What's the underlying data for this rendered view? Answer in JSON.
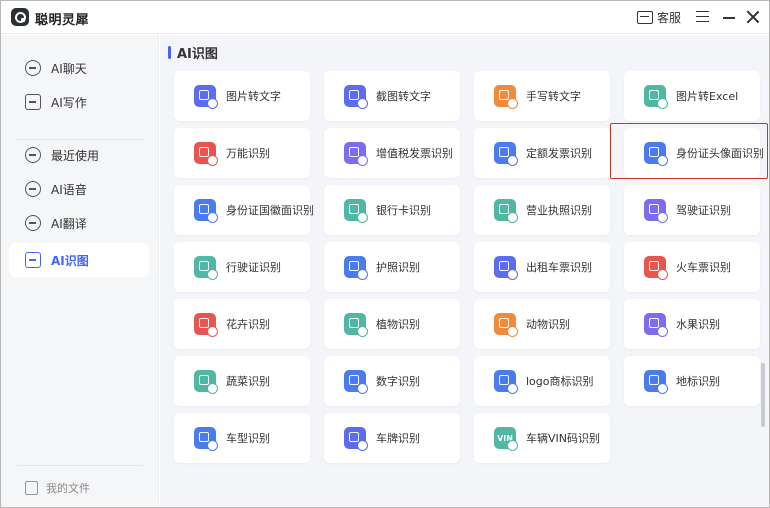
{
  "app": {
    "title": "聪明灵犀"
  },
  "titlebar": {
    "service_label": "客服"
  },
  "sidebar": {
    "items": [
      {
        "label": "AI聊天",
        "active": false
      },
      {
        "label": "AI写作",
        "active": false
      },
      {
        "label": "最近使用",
        "active": false
      },
      {
        "label": "AI语音",
        "active": false
      },
      {
        "label": "AI翻译",
        "active": false
      },
      {
        "label": "AI识图",
        "active": true
      }
    ],
    "files_label": "我的文件"
  },
  "main": {
    "section_title": "AI识图",
    "cards": [
      {
        "label": "图片转文字",
        "color": "#5b6cf0"
      },
      {
        "label": "截图转文字",
        "color": "#5b6cf0"
      },
      {
        "label": "手写转文字",
        "color": "#f08a3c"
      },
      {
        "label": "图片转Excel",
        "color": "#4fb7a3"
      },
      {
        "label": "万能识别",
        "color": "#e8554e"
      },
      {
        "label": "增值税发票识别",
        "color": "#7b6cf0"
      },
      {
        "label": "定额发票识别",
        "color": "#4a7cf0"
      },
      {
        "label": "身份证头像面识别",
        "color": "#4a7cf0"
      },
      {
        "label": "身份证国徽面识别",
        "color": "#4a7cf0"
      },
      {
        "label": "银行卡识别",
        "color": "#4fb7a3"
      },
      {
        "label": "营业执照识别",
        "color": "#4fb7a3"
      },
      {
        "label": "驾驶证识别",
        "color": "#7b6cf0"
      },
      {
        "label": "行驶证识别",
        "color": "#4fb7a3"
      },
      {
        "label": "护照识别",
        "color": "#4a7cf0"
      },
      {
        "label": "出租车票识别",
        "color": "#5b6cf0"
      },
      {
        "label": "火车票识别",
        "color": "#e8554e"
      },
      {
        "label": "花卉识别",
        "color": "#e8554e"
      },
      {
        "label": "植物识别",
        "color": "#4fb7a3"
      },
      {
        "label": "动物识别",
        "color": "#f08a3c"
      },
      {
        "label": "水果识别",
        "color": "#7b6cf0"
      },
      {
        "label": "蔬菜识别",
        "color": "#4fb7a3"
      },
      {
        "label": "数字识别",
        "color": "#4a7cf0"
      },
      {
        "label": "logo商标识别",
        "color": "#4a7cf0"
      },
      {
        "label": "地标识别",
        "color": "#4a7cf0"
      },
      {
        "label": "车型识别",
        "color": "#4a7cf0"
      },
      {
        "label": "车牌识别",
        "color": "#5b6cf0"
      },
      {
        "label": "车辆VIN码识别",
        "color": "#4fb7a3",
        "glyph": "VIN"
      }
    ]
  },
  "colors": {
    "accent": "#4466f5",
    "highlight": "#c0392b"
  }
}
